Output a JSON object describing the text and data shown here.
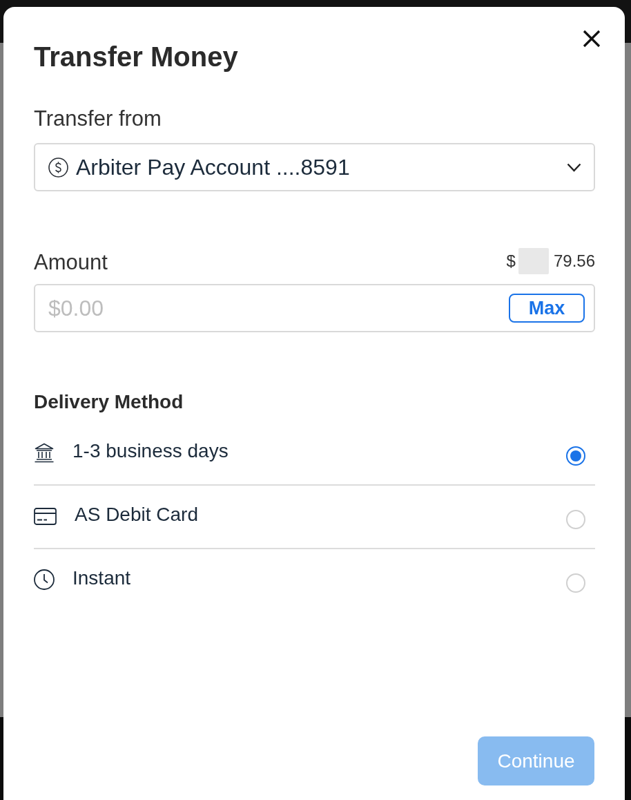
{
  "dialog": {
    "title": "Transfer Money"
  },
  "transfer_from": {
    "label": "Transfer from",
    "account": "Arbiter Pay Account ....8591"
  },
  "amount": {
    "label": "Amount",
    "balance": {
      "prefix": "$",
      "redacted": true,
      "suffix": "79.56"
    },
    "placeholder": "$0.00",
    "max_button": "Max"
  },
  "delivery": {
    "heading": "Delivery Method",
    "options": [
      {
        "kind": "bank",
        "label": "1-3 business days",
        "selected": true
      },
      {
        "kind": "card",
        "label": "AS Debit Card",
        "selected": false
      },
      {
        "kind": "instant",
        "label": "Instant",
        "selected": false
      }
    ]
  },
  "continue_button": {
    "label": "Continue",
    "disabled": true
  }
}
